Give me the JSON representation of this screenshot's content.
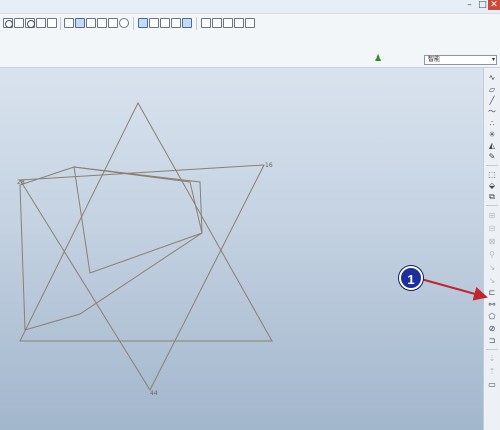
{
  "toolbar": {
    "icons": [
      "zoom-in",
      "zoom-fit",
      "zoom-out",
      "refit",
      "save-view",
      "display-style-shaded",
      "display-style-wireframe",
      "display-style-hidden",
      "display-style-no-hidden",
      "display-style-shading",
      "named-view",
      "datum-planes",
      "datum-axes",
      "datum-points",
      "coordinate-systems",
      "sketch-grid",
      "sketch-vertices",
      "sketch-constraints",
      "sketch-dimensions",
      "sketch-setup"
    ]
  },
  "status": {
    "filter_value": "智能",
    "filter_arrow": "▾"
  },
  "sketch": {
    "vertex_labels": [
      "16",
      "28",
      "44"
    ]
  },
  "rightbar": {
    "tools": [
      "line",
      "rectangle",
      "line-single",
      "spline",
      "point",
      "centerline-point",
      "arc",
      "fillet",
      "use-edge",
      "offset-edge",
      "thicken",
      "trim",
      "mirror",
      "divide",
      "delete-segment",
      "constraint",
      "dimension",
      "modify",
      "palette",
      "text",
      "done",
      "quit",
      "undo"
    ]
  },
  "callout": {
    "number": "1",
    "color": "#1c2f9c",
    "arrow_color": "#c0262c"
  }
}
